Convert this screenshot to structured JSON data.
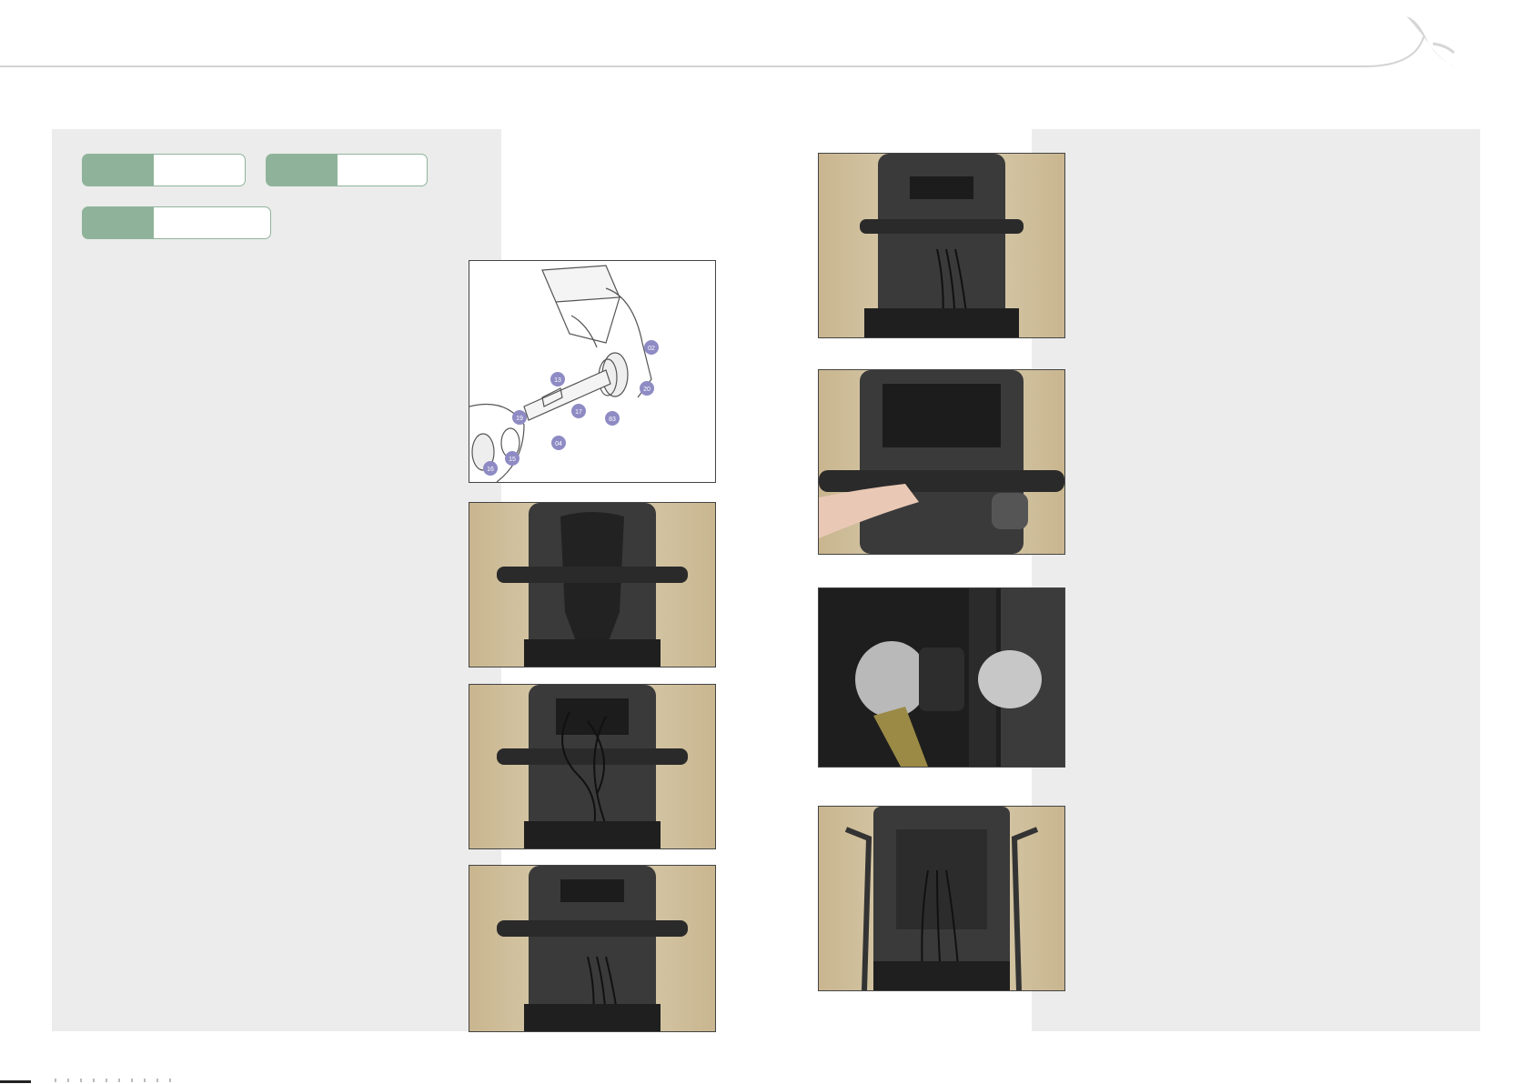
{
  "header": {
    "logo_icon": "bird-swoosh-icon",
    "line_color": "#d3d3d3"
  },
  "tabs": [
    {
      "label": ""
    },
    {
      "label": ""
    },
    {
      "label": ""
    }
  ],
  "diagram": {
    "callouts": [
      "02",
      "13",
      "20",
      "19",
      "17",
      "83",
      "04",
      "15",
      "16"
    ]
  },
  "figures": [
    {
      "name": "exploded-view-diagram"
    },
    {
      "name": "seat-back-cover-photo"
    },
    {
      "name": "seat-back-cables-photo"
    },
    {
      "name": "seat-back-bar-photo"
    },
    {
      "name": "seat-back-tilt-bar-photo"
    },
    {
      "name": "hand-on-bar-photo"
    },
    {
      "name": "ball-joint-closeup-photo"
    },
    {
      "name": "seat-back-rods-photo"
    }
  ],
  "colors": {
    "panel": "#ececec",
    "tab_green": "#8fb39a",
    "callout": "#8e8bc4"
  }
}
